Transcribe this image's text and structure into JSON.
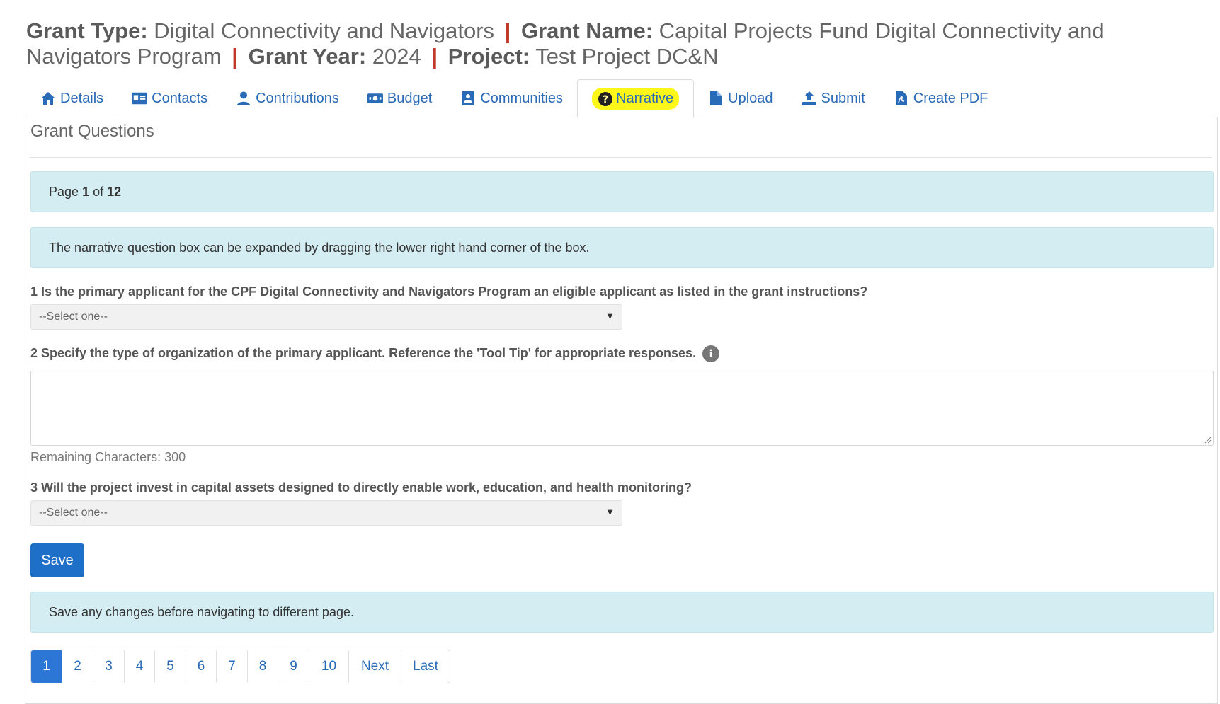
{
  "header": {
    "grant_type_label": "Grant Type:",
    "grant_type_value": "Digital Connectivity and Navigators",
    "grant_name_label": "Grant Name:",
    "grant_name_value": "Capital Projects Fund Digital Connectivity and Navigators Program",
    "grant_year_label": "Grant Year:",
    "grant_year_value": "2024",
    "project_label": "Project:",
    "project_value": "Test Project DC&N",
    "separator": "|"
  },
  "tabs": [
    {
      "label": "Details",
      "icon": "home-icon"
    },
    {
      "label": "Contacts",
      "icon": "id-card-icon"
    },
    {
      "label": "Contributions",
      "icon": "user-icon"
    },
    {
      "label": "Budget",
      "icon": "money-bill-icon"
    },
    {
      "label": "Communities",
      "icon": "address-book-icon"
    },
    {
      "label": "Narrative",
      "icon": "question-circle-icon",
      "active": true,
      "highlight_color": "#fff71a"
    },
    {
      "label": "Upload",
      "icon": "file-icon"
    },
    {
      "label": "Submit",
      "icon": "upload-icon"
    },
    {
      "label": "Create PDF",
      "icon": "file-pdf-icon"
    }
  ],
  "panel": {
    "title": "Grant Questions",
    "page_info": {
      "prefix": "Page",
      "current": "1",
      "of": "of",
      "total": "12"
    },
    "instruction": "The narrative question box can be expanded by dragging the lower right hand corner of the box.",
    "questions": [
      {
        "text": "1 Is the primary applicant for the CPF Digital Connectivity and Navigators Program an eligible applicant as listed in the grant instructions?",
        "type": "select",
        "value": "--Select one--"
      },
      {
        "text": "2 Specify the type of organization of the primary applicant. Reference the 'Tool Tip' for appropriate responses.",
        "type": "textarea",
        "value": "",
        "remaining": "Remaining Characters: 300",
        "tooltip_icon": "info-icon"
      },
      {
        "text": "3 Will the project invest in capital assets designed to directly enable work, education, and health monitoring?",
        "type": "select",
        "value": "--Select one--"
      }
    ],
    "save_label": "Save",
    "save_notice": "Save any changes before navigating to different page.",
    "pagination": [
      "1",
      "2",
      "3",
      "4",
      "5",
      "6",
      "7",
      "8",
      "9",
      "10",
      "Next",
      "Last"
    ],
    "pagination_active": "1"
  },
  "colors": {
    "link": "#2a6bb8",
    "separator": "#c0392b",
    "alert_bg": "#d4edf2",
    "primary_button": "#1d6fc8",
    "active_page": "#2c76d6"
  }
}
